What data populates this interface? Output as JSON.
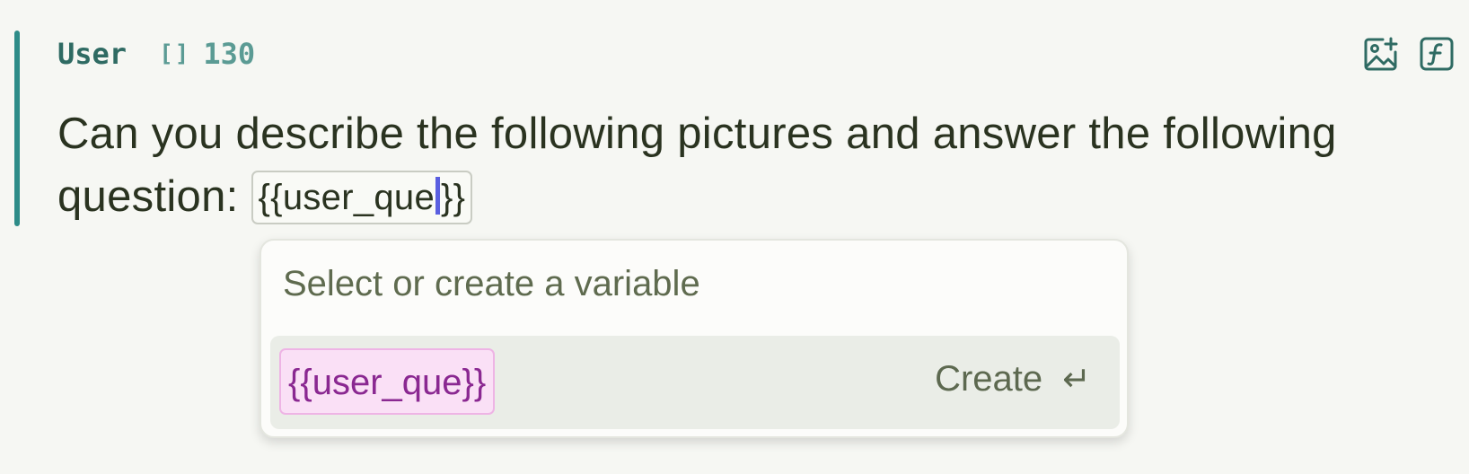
{
  "message": {
    "role": "User",
    "token_icon": "[]",
    "token_count": "130",
    "text_before": "Can you describe the following pictures and answer the following question: ",
    "variable_open": "{{user_que",
    "variable_close": "}}"
  },
  "header_icons": {
    "add_image": "add-image-icon",
    "function": "function-icon"
  },
  "dropdown": {
    "placeholder": "Select or create a variable",
    "option_variable": "{{user_que}}",
    "create_label": "Create",
    "enter_glyph": "↵"
  },
  "colors": {
    "accent": "#2e8c88",
    "variable_tag_bg": "#fae0f6",
    "variable_tag_text": "#8a2891",
    "caret": "#5a5fe0"
  }
}
